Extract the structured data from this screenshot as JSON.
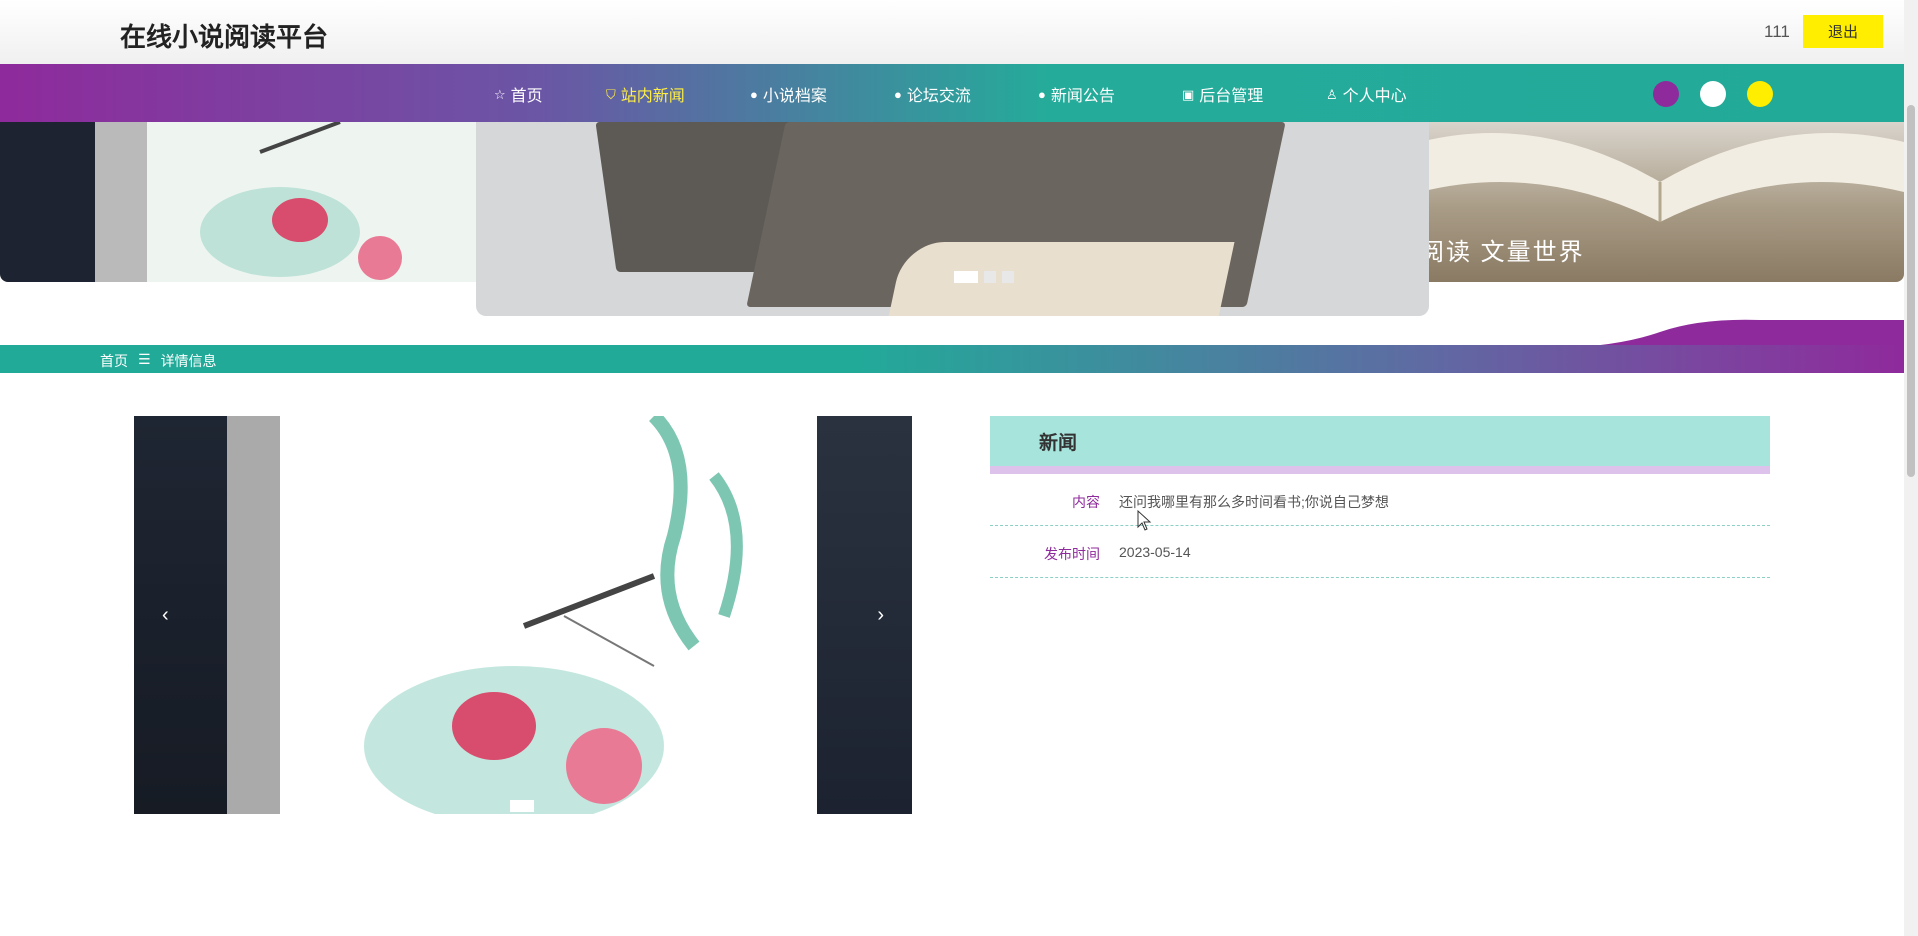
{
  "header": {
    "title": "在线小说阅读平台",
    "username": "111",
    "logout_label": "退出"
  },
  "nav": {
    "items": [
      {
        "label": "首页",
        "icon": "star-icon"
      },
      {
        "label": "站内新闻",
        "icon": "bag-icon",
        "active": true
      },
      {
        "label": "小说档案",
        "icon": "info-icon"
      },
      {
        "label": "论坛交流",
        "icon": "question-icon"
      },
      {
        "label": "新闻公告",
        "icon": "info-icon"
      },
      {
        "label": "后台管理",
        "icon": "briefcase-icon"
      },
      {
        "label": "个人中心",
        "icon": "user-icon"
      }
    ],
    "theme_colors": [
      "#8f2a9c",
      "#ffffff",
      "#ffee00"
    ]
  },
  "banner": {
    "slides": 3,
    "active_slide": 1,
    "right_panel_text": "阅读 文量世界"
  },
  "breadcrumb": {
    "home": "首页",
    "separator": "☰",
    "current": "详情信息"
  },
  "detail": {
    "image_slides": 1,
    "prev_arrow": "‹",
    "next_arrow": "›"
  },
  "info": {
    "title": "新闻",
    "rows": [
      {
        "label": "内容",
        "value": "还问我哪里有那么多时间看书;你说自己梦想"
      },
      {
        "label": "发布时间",
        "value": "2023-05-14"
      }
    ]
  },
  "colors": {
    "accent_purple": "#8f2a9c",
    "accent_teal": "#22aa99",
    "logout_yellow": "#ffee00"
  }
}
